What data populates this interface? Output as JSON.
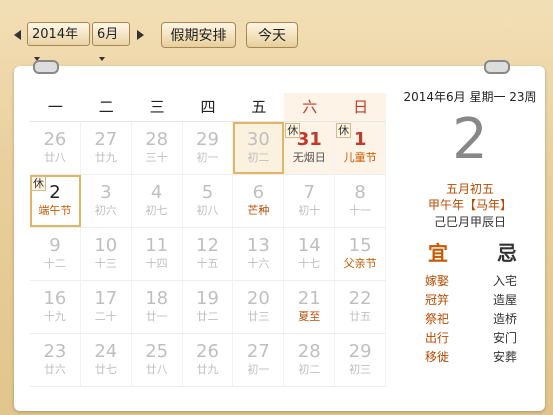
{
  "toolbar": {
    "year": "2014年",
    "month": "6月",
    "holiday_btn": "假期安排",
    "today_btn": "今天"
  },
  "weekdays": [
    "一",
    "二",
    "三",
    "四",
    "五",
    "六",
    "日"
  ],
  "rows": [
    [
      {
        "d": "26",
        "l": "廿八"
      },
      {
        "d": "27",
        "l": "廿九"
      },
      {
        "d": "28",
        "l": "三十"
      },
      {
        "d": "29",
        "l": "初一"
      },
      {
        "d": "30",
        "l": "初二"
      },
      {
        "d": "31",
        "l": "无烟日",
        "xiu": "休"
      },
      {
        "d": "1",
        "l": "儿童节",
        "xiu": "休"
      }
    ],
    [
      {
        "d": "2",
        "l": "端午节",
        "xiu": "休"
      },
      {
        "d": "3",
        "l": "初六"
      },
      {
        "d": "4",
        "l": "初七"
      },
      {
        "d": "5",
        "l": "初八"
      },
      {
        "d": "6",
        "l": "芒种"
      },
      {
        "d": "7",
        "l": "初十"
      },
      {
        "d": "8",
        "l": "十一"
      }
    ],
    [
      {
        "d": "9",
        "l": "十二"
      },
      {
        "d": "10",
        "l": "十三"
      },
      {
        "d": "11",
        "l": "十四"
      },
      {
        "d": "12",
        "l": "十五"
      },
      {
        "d": "13",
        "l": "十六"
      },
      {
        "d": "14",
        "l": "十七"
      },
      {
        "d": "15",
        "l": "父亲节"
      }
    ],
    [
      {
        "d": "16",
        "l": "十九"
      },
      {
        "d": "17",
        "l": "二十"
      },
      {
        "d": "18",
        "l": "廿一"
      },
      {
        "d": "19",
        "l": "廿二"
      },
      {
        "d": "20",
        "l": "廿三"
      },
      {
        "d": "21",
        "l": "夏至"
      },
      {
        "d": "22",
        "l": "廿五"
      }
    ],
    [
      {
        "d": "23",
        "l": "廿六"
      },
      {
        "d": "24",
        "l": "廿七"
      },
      {
        "d": "25",
        "l": "廿八"
      },
      {
        "d": "26",
        "l": "廿九"
      },
      {
        "d": "27",
        "l": "初一"
      },
      {
        "d": "28",
        "l": "初二"
      },
      {
        "d": "29",
        "l": "初三"
      }
    ]
  ],
  "side": {
    "date_line": "2014年6月 星期一 23周",
    "big_day": "2",
    "lunar": "五月初五",
    "year_gz": "甲午年【马年】",
    "month_day_gz": "己巳月甲辰日",
    "yi_label": "宜",
    "ji_label": "忌",
    "yi": [
      "嫁娶",
      "冠笄",
      "祭祀",
      "出行",
      "移徙"
    ],
    "ji": [
      "入宅",
      "造屋",
      "造桥",
      "安门",
      "安葬"
    ]
  },
  "colors": {
    "accent": "#c0392b",
    "lunar": "#b84a00",
    "frame": "#e9cf9c"
  }
}
